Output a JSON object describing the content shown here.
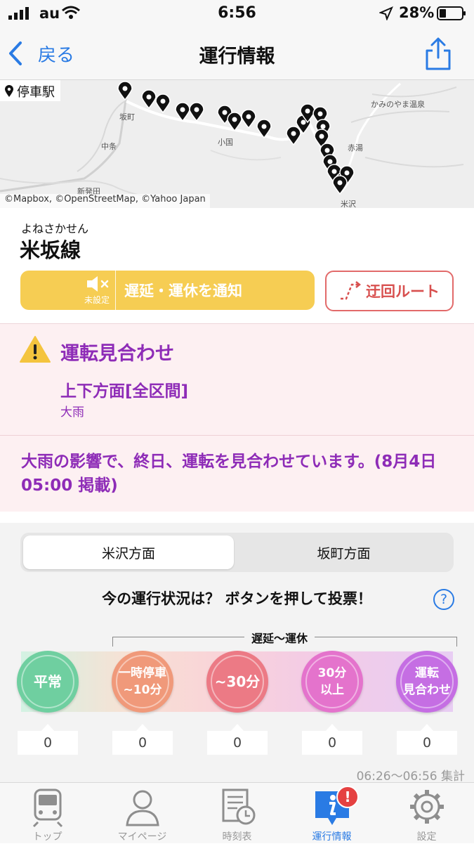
{
  "status_bar": {
    "carrier": "au",
    "time": "6:56",
    "battery": "28%"
  },
  "nav": {
    "back_label": "戻る",
    "title": "運行情報"
  },
  "map": {
    "legend": "停車駅",
    "attribution": "©Mapbox, ©OpenStreetMap, ©Yahoo Japan",
    "place_labels": [
      "坂町",
      "中条",
      "新発田",
      "小国",
      "かみのやま温泉",
      "赤湯",
      "米沢"
    ]
  },
  "line": {
    "kana": "よねさかせん",
    "name": "米坂線"
  },
  "actions": {
    "notify_state": "未設定",
    "notify_label": "遅延・運休を通知",
    "detour_label": "迂回ルート"
  },
  "status": {
    "title": "運転見合わせ",
    "section": "上下方面[全区間]",
    "cause": "大雨",
    "message": "大雨の影響で、終日、運転を見合わせています。(8月4日05:00 掲載)"
  },
  "directions": {
    "a": "米沢方面",
    "b": "坂町方面"
  },
  "vote": {
    "prompt": "今の運行状況は？ ボタンを押して投票！",
    "help": "?",
    "group_label": "遅延〜運休",
    "options": [
      {
        "line1": "平常",
        "line2": "",
        "count": "0",
        "color": "#6fcfa0"
      },
      {
        "line1": "一時停車",
        "line2": "~10分",
        "count": "0",
        "color": "#f0997a"
      },
      {
        "line1": "~30分",
        "line2": "",
        "count": "0",
        "color": "#ec7a85"
      },
      {
        "line1": "30分",
        "line2": "以上",
        "count": "0",
        "color": "#e473cc"
      },
      {
        "line1": "運転",
        "line2": "見合わせ",
        "count": "0",
        "color": "#c56ee3"
      }
    ],
    "tally": "06:26〜06:56 集計"
  },
  "tabs": [
    {
      "label": "トップ",
      "icon": "train-icon"
    },
    {
      "label": "マイページ",
      "icon": "person-icon"
    },
    {
      "label": "時刻表",
      "icon": "timetable-icon"
    },
    {
      "label": "運行情報",
      "icon": "info-icon",
      "badge": "!"
    },
    {
      "label": "設定",
      "icon": "gear-icon"
    }
  ]
}
